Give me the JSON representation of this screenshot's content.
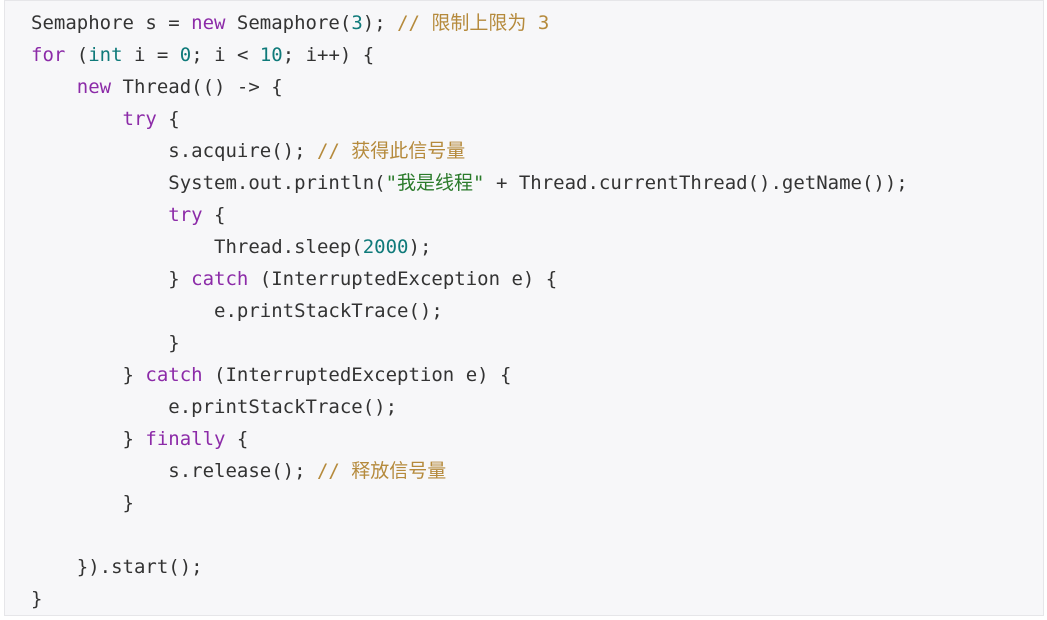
{
  "code_lines": [
    "Semaphore s = new Semaphore(3); // 限制上限为 3",
    "for (int i = 0; i < 10; i++) {",
    "    new Thread(() -> {",
    "        try {",
    "            s.acquire(); // 获得此信号量",
    "            System.out.println(\"我是线程\" + Thread.currentThread().getName());",
    "            try {",
    "                Thread.sleep(2000);",
    "            } catch (InterruptedException e) {",
    "                e.printStackTrace();",
    "            }",
    "        } catch (InterruptedException e) {",
    "            e.printStackTrace();",
    "        } finally {",
    "            s.release(); // 释放信号量",
    "        }",
    "",
    "    }).start();",
    "}"
  ],
  "colors": {
    "background": "#f7f7f9",
    "text": "#333333",
    "keyword": "#8c2ba8",
    "type": "#0f7a7a",
    "number": "#0f7a7a",
    "string": "#2a7a2a",
    "comment": "#b58a3c"
  }
}
